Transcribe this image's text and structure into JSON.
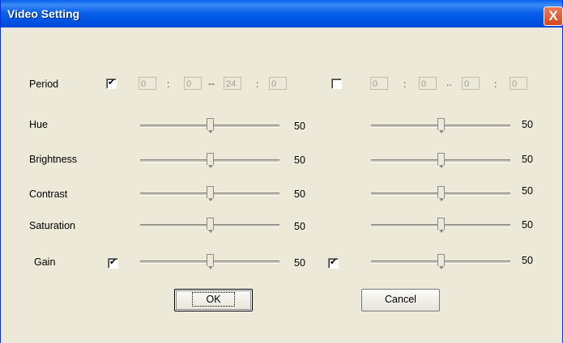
{
  "window": {
    "title": "Video Setting",
    "close_glyph": "X"
  },
  "period": {
    "label": "Period",
    "left": {
      "enabled": true,
      "from_h": "0",
      "from_m": "0",
      "to_h": "24",
      "to_m": "0"
    },
    "right": {
      "enabled": false,
      "from_h": "0",
      "from_m": "0",
      "to_h": "0",
      "to_m": "0"
    },
    "colon": ":",
    "dash_left": "--",
    "dash_right": ".."
  },
  "rows": [
    {
      "label": "Hue",
      "left_value": "50",
      "right_value": "50"
    },
    {
      "label": "Brightness",
      "left_value": "50",
      "right_value": "50"
    },
    {
      "label": "Contrast",
      "left_value": "50",
      "right_value": "50"
    },
    {
      "label": "Saturation",
      "left_value": "50",
      "right_value": "50"
    }
  ],
  "gain": {
    "label": "Gain",
    "left_checked": true,
    "right_checked": true,
    "left_value": "50",
    "right_value": "50"
  },
  "slider_fraction": 0.5,
  "buttons": {
    "ok": "OK",
    "cancel": "Cancel"
  }
}
